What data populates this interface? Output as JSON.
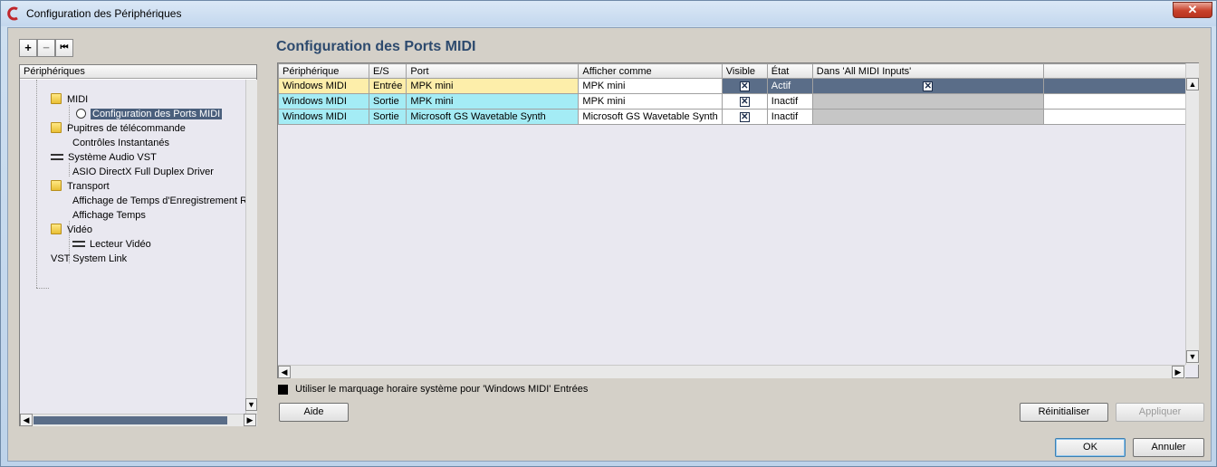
{
  "window": {
    "title": "Configuration des Périphériques",
    "close_glyph": "✕"
  },
  "toolbar": {
    "add_glyph": "+",
    "remove_glyph": "−",
    "reset_glyph": "⏮"
  },
  "panel": {
    "title": "Configuration des Ports MIDI"
  },
  "tree": {
    "header": "Périphériques",
    "items": [
      {
        "label": "MIDI"
      },
      {
        "label": "Configuration des Ports MIDI"
      },
      {
        "label": "Pupitres de télécommande"
      },
      {
        "label": "Contrôles Instantanés"
      },
      {
        "label": "Système Audio VST"
      },
      {
        "label": "ASIO DirectX Full Duplex Driver"
      },
      {
        "label": "Transport"
      },
      {
        "label": "Affichage de Temps d'Enregistrement Rest"
      },
      {
        "label": "Affichage Temps"
      },
      {
        "label": "Vidéo"
      },
      {
        "label": "Lecteur Vidéo"
      },
      {
        "label": "VST System Link"
      }
    ]
  },
  "grid": {
    "columns": [
      "Périphérique",
      "E/S",
      "Port",
      "Afficher comme",
      "Visible",
      "État",
      "Dans 'All MIDI Inputs'",
      ""
    ],
    "rows": [
      {
        "device": "Windows MIDI",
        "io": "Entrée",
        "port": "MPK mini",
        "display": "MPK mini",
        "visible": "✕",
        "state": "Actif",
        "all_inputs": "✕"
      },
      {
        "device": "Windows MIDI",
        "io": "Sortie",
        "port": "MPK mini",
        "display": "MPK mini",
        "visible": "✕",
        "state": "Inactif",
        "all_inputs": ""
      },
      {
        "device": "Windows MIDI",
        "io": "Sortie",
        "port": "Microsoft GS Wavetable Synth",
        "display": "Microsoft GS Wavetable Synth",
        "visible": "✕",
        "state": "Inactif",
        "all_inputs": ""
      }
    ]
  },
  "options": {
    "timestamp_label": "Utiliser le marquage horaire système pour 'Windows MIDI' Entrées"
  },
  "buttons": {
    "help": "Aide",
    "reset": "Réinitialiser",
    "apply": "Appliquer",
    "ok": "OK",
    "cancel": "Annuler"
  },
  "scroll": {
    "up": "▲",
    "down": "▼",
    "left": "◀",
    "right": "▶"
  }
}
